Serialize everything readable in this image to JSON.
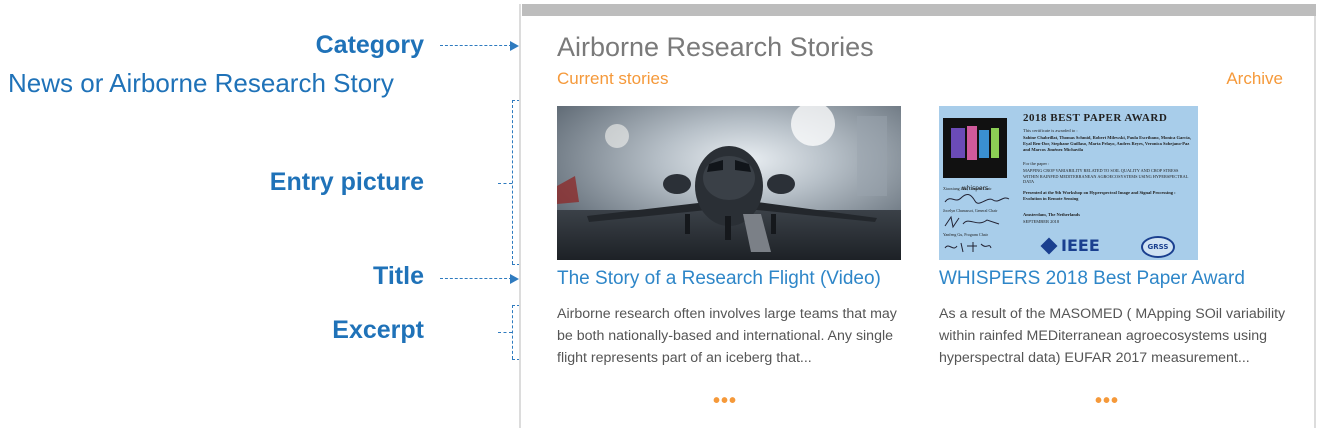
{
  "annotations": {
    "category": "Category",
    "category_sub": "News or Airborne Research Story",
    "entry_picture": "Entry  picture",
    "title": "Title",
    "excerpt": "Excerpt"
  },
  "widget": {
    "heading": "Airborne Research Stories",
    "current_link": "Current stories",
    "archive_link": "Archive",
    "cards": [
      {
        "title": "The Story of a Research Flight (Video)",
        "excerpt": "Airborne research often involves large teams that may be both nationally-based and international. Any single flight represents part of an iceberg that...",
        "more": "•••"
      },
      {
        "title": "WHISPERS 2018 Best Paper Award",
        "excerpt": "As a result of the MASOMED ( MApping SOil variability within rainfed MEDiterranean agroecosystems using hyperspectral data) EUFAR 2017 measurement...",
        "more": "•••"
      }
    ]
  },
  "certificate": {
    "heading": "2018 BEST PAPER AWARD",
    "awarded": "This certificate is awarded to :",
    "names": "Sabine Chabrillat, Thomas Schmid, Robert Milewski, Paula Escribano, Monica Garcia, Eyal Ben-Dor, Stephane Guillaso, Marta Pelayo, Andres Reyes, Veronica Sobejano-Paz and Marcos Jiménez Michavila",
    "for_paper": "For the paper :",
    "paper": "MAPPING CROP VARIABILITY RELATED TO SOIL QUALITY AND CROP STRESS WITHIN RAINFED MEDITERRANEAN AGROECOSYSTEMS USING HYPERSPECTRAL DATA",
    "presented": "Presented at the 9th Workshop on Hyperspectral Image and Signal Processing : Evolution in Remote Sensing",
    "place": "Amsterdam, The Netherlands",
    "date": "SEPTEMBER 2018",
    "logo_word": "whispers",
    "chair1": "Xiaoxiang Zhu, General Chair",
    "chair2": "Jocelyn Chanussot, General Chair",
    "chair3": "Yanfeng Gu, Program Chair",
    "ieee": "IEEE",
    "grss": "GRSS"
  },
  "colors": {
    "annotation_blue": "#1f72b8",
    "link_orange": "#f5993a",
    "title_blue": "#2e86c8",
    "certificate_bg": "#a8cdea"
  }
}
